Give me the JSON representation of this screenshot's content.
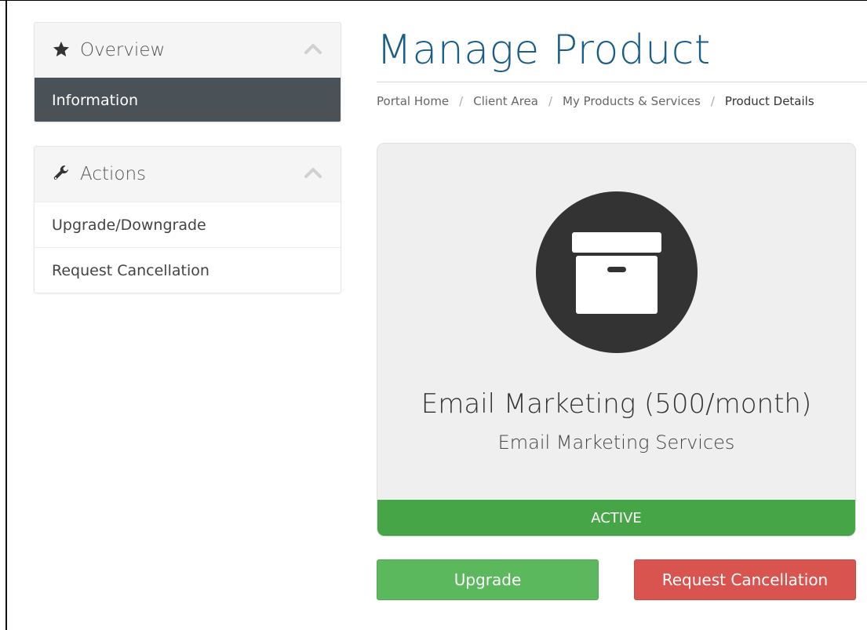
{
  "sidebar": {
    "overview": {
      "title": "Overview",
      "icon": "star-icon",
      "items": [
        {
          "label": "Information",
          "active": true
        }
      ]
    },
    "actions": {
      "title": "Actions",
      "icon": "wrench-icon",
      "items": [
        {
          "label": "Upgrade/Downgrade"
        },
        {
          "label": "Request Cancellation"
        }
      ]
    }
  },
  "main": {
    "title": "Manage Product",
    "breadcrumb": {
      "items": [
        "Portal Home",
        "Client Area",
        "My Products & Services",
        "Product Details"
      ],
      "separator": "/"
    },
    "product": {
      "icon": "archive-box-icon",
      "name": "Email Marketing (500/month)",
      "group": "Email Marketing Services",
      "status": "ACTIVE"
    },
    "buttons": {
      "upgrade": "Upgrade",
      "cancel": "Request Cancellation"
    }
  },
  "colors": {
    "title": "#1a5d8a",
    "active_item": "#4a5157",
    "status_active": "#46a546",
    "upgrade": "#5cb85c",
    "cancel": "#d9534f"
  }
}
